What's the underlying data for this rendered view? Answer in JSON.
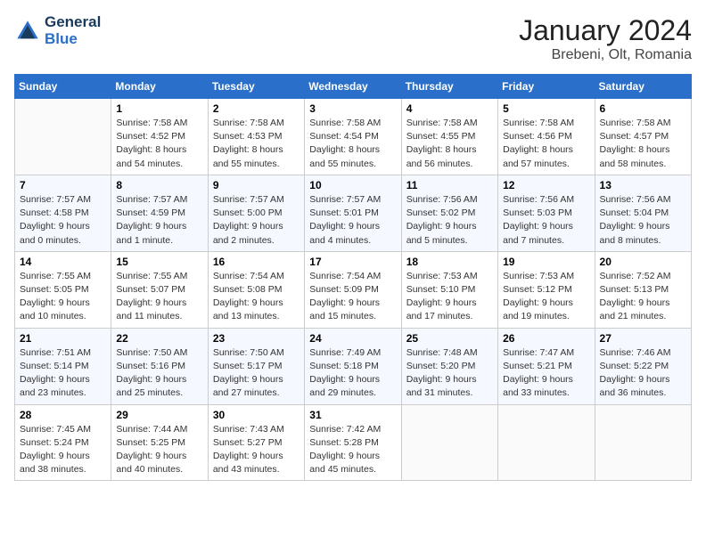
{
  "header": {
    "logo_line1": "General",
    "logo_line2": "Blue",
    "month": "January 2024",
    "location": "Brebeni, Olt, Romania"
  },
  "weekdays": [
    "Sunday",
    "Monday",
    "Tuesday",
    "Wednesday",
    "Thursday",
    "Friday",
    "Saturday"
  ],
  "weeks": [
    [
      {
        "day": "",
        "info": ""
      },
      {
        "day": "1",
        "info": "Sunrise: 7:58 AM\nSunset: 4:52 PM\nDaylight: 8 hours\nand 54 minutes."
      },
      {
        "day": "2",
        "info": "Sunrise: 7:58 AM\nSunset: 4:53 PM\nDaylight: 8 hours\nand 55 minutes."
      },
      {
        "day": "3",
        "info": "Sunrise: 7:58 AM\nSunset: 4:54 PM\nDaylight: 8 hours\nand 55 minutes."
      },
      {
        "day": "4",
        "info": "Sunrise: 7:58 AM\nSunset: 4:55 PM\nDaylight: 8 hours\nand 56 minutes."
      },
      {
        "day": "5",
        "info": "Sunrise: 7:58 AM\nSunset: 4:56 PM\nDaylight: 8 hours\nand 57 minutes."
      },
      {
        "day": "6",
        "info": "Sunrise: 7:58 AM\nSunset: 4:57 PM\nDaylight: 8 hours\nand 58 minutes."
      }
    ],
    [
      {
        "day": "7",
        "info": "Sunrise: 7:57 AM\nSunset: 4:58 PM\nDaylight: 9 hours\nand 0 minutes."
      },
      {
        "day": "8",
        "info": "Sunrise: 7:57 AM\nSunset: 4:59 PM\nDaylight: 9 hours\nand 1 minute."
      },
      {
        "day": "9",
        "info": "Sunrise: 7:57 AM\nSunset: 5:00 PM\nDaylight: 9 hours\nand 2 minutes."
      },
      {
        "day": "10",
        "info": "Sunrise: 7:57 AM\nSunset: 5:01 PM\nDaylight: 9 hours\nand 4 minutes."
      },
      {
        "day": "11",
        "info": "Sunrise: 7:56 AM\nSunset: 5:02 PM\nDaylight: 9 hours\nand 5 minutes."
      },
      {
        "day": "12",
        "info": "Sunrise: 7:56 AM\nSunset: 5:03 PM\nDaylight: 9 hours\nand 7 minutes."
      },
      {
        "day": "13",
        "info": "Sunrise: 7:56 AM\nSunset: 5:04 PM\nDaylight: 9 hours\nand 8 minutes."
      }
    ],
    [
      {
        "day": "14",
        "info": "Sunrise: 7:55 AM\nSunset: 5:05 PM\nDaylight: 9 hours\nand 10 minutes."
      },
      {
        "day": "15",
        "info": "Sunrise: 7:55 AM\nSunset: 5:07 PM\nDaylight: 9 hours\nand 11 minutes."
      },
      {
        "day": "16",
        "info": "Sunrise: 7:54 AM\nSunset: 5:08 PM\nDaylight: 9 hours\nand 13 minutes."
      },
      {
        "day": "17",
        "info": "Sunrise: 7:54 AM\nSunset: 5:09 PM\nDaylight: 9 hours\nand 15 minutes."
      },
      {
        "day": "18",
        "info": "Sunrise: 7:53 AM\nSunset: 5:10 PM\nDaylight: 9 hours\nand 17 minutes."
      },
      {
        "day": "19",
        "info": "Sunrise: 7:53 AM\nSunset: 5:12 PM\nDaylight: 9 hours\nand 19 minutes."
      },
      {
        "day": "20",
        "info": "Sunrise: 7:52 AM\nSunset: 5:13 PM\nDaylight: 9 hours\nand 21 minutes."
      }
    ],
    [
      {
        "day": "21",
        "info": "Sunrise: 7:51 AM\nSunset: 5:14 PM\nDaylight: 9 hours\nand 23 minutes."
      },
      {
        "day": "22",
        "info": "Sunrise: 7:50 AM\nSunset: 5:16 PM\nDaylight: 9 hours\nand 25 minutes."
      },
      {
        "day": "23",
        "info": "Sunrise: 7:50 AM\nSunset: 5:17 PM\nDaylight: 9 hours\nand 27 minutes."
      },
      {
        "day": "24",
        "info": "Sunrise: 7:49 AM\nSunset: 5:18 PM\nDaylight: 9 hours\nand 29 minutes."
      },
      {
        "day": "25",
        "info": "Sunrise: 7:48 AM\nSunset: 5:20 PM\nDaylight: 9 hours\nand 31 minutes."
      },
      {
        "day": "26",
        "info": "Sunrise: 7:47 AM\nSunset: 5:21 PM\nDaylight: 9 hours\nand 33 minutes."
      },
      {
        "day": "27",
        "info": "Sunrise: 7:46 AM\nSunset: 5:22 PM\nDaylight: 9 hours\nand 36 minutes."
      }
    ],
    [
      {
        "day": "28",
        "info": "Sunrise: 7:45 AM\nSunset: 5:24 PM\nDaylight: 9 hours\nand 38 minutes."
      },
      {
        "day": "29",
        "info": "Sunrise: 7:44 AM\nSunset: 5:25 PM\nDaylight: 9 hours\nand 40 minutes."
      },
      {
        "day": "30",
        "info": "Sunrise: 7:43 AM\nSunset: 5:27 PM\nDaylight: 9 hours\nand 43 minutes."
      },
      {
        "day": "31",
        "info": "Sunrise: 7:42 AM\nSunset: 5:28 PM\nDaylight: 9 hours\nand 45 minutes."
      },
      {
        "day": "",
        "info": ""
      },
      {
        "day": "",
        "info": ""
      },
      {
        "day": "",
        "info": ""
      }
    ]
  ]
}
